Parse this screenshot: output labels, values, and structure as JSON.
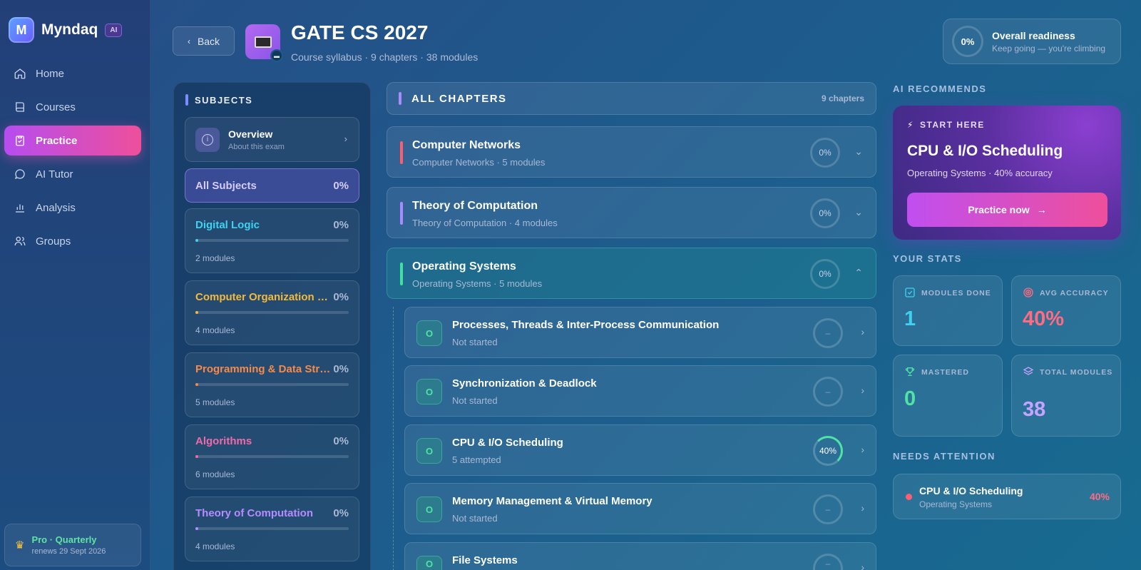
{
  "brand": {
    "name": "Myndaq",
    "badge": "AI",
    "logo_letter": "M"
  },
  "nav": {
    "items": [
      {
        "label": "Home",
        "icon": "home-icon"
      },
      {
        "label": "Courses",
        "icon": "book-icon"
      },
      {
        "label": "Practice",
        "icon": "clipboard-icon",
        "active": true
      },
      {
        "label": "AI Tutor",
        "icon": "chat-icon"
      },
      {
        "label": "Analysis",
        "icon": "bar-chart-icon"
      },
      {
        "label": "Groups",
        "icon": "users-icon"
      }
    ]
  },
  "plan": {
    "title": "Pro · Quarterly",
    "sub": "renews 29 Sept 2026",
    "icon": "crown-icon"
  },
  "header": {
    "back_label": "Back",
    "title": "GATE CS 2027",
    "subtitle": "Course syllabus · 9 chapters · 38 modules",
    "readiness": {
      "value": "0%",
      "title": "Overall readiness",
      "sub": "Keep going — you're climbing"
    }
  },
  "subjects": {
    "heading": "SUBJECTS",
    "overview": {
      "title": "Overview",
      "sub": "About this exam"
    },
    "all": {
      "label": "All Subjects",
      "pct": "0%"
    },
    "items": [
      {
        "name": "Digital Logic",
        "pct": "0%",
        "modules": "2 modules",
        "color": "#3fd2f0",
        "progress": 0
      },
      {
        "name": "Computer Organization …",
        "pct": "0%",
        "modules": "4 modules",
        "color": "#f5b93a",
        "progress": 0
      },
      {
        "name": "Programming & Data Str…",
        "pct": "0%",
        "modules": "5 modules",
        "color": "#f58a4a",
        "progress": 0
      },
      {
        "name": "Algorithms",
        "pct": "0%",
        "modules": "6 modules",
        "color": "#f06aa8",
        "progress": 0
      },
      {
        "name": "Theory of Computation",
        "pct": "0%",
        "modules": "4 modules",
        "color": "#b68bff",
        "progress": 0
      }
    ]
  },
  "chapters": {
    "heading": "ALL CHAPTERS",
    "count": "9 chapters",
    "items": [
      {
        "name": "Computer Networks",
        "sub": "Computer Networks · 5 modules",
        "pct": "0%",
        "color": "#ff5d6c",
        "chevron": "⌄"
      },
      {
        "name": "Theory of Computation",
        "sub": "Theory of Computation · 4 modules",
        "pct": "0%",
        "color": "#a98bff",
        "chevron": "⌄"
      },
      {
        "name": "Operating Systems",
        "sub": "Operating Systems · 5 modules",
        "pct": "0%",
        "color": "#3fe0a0",
        "chevron": "⌃"
      }
    ],
    "modules": [
      {
        "badge": "O",
        "name": "Processes, Threads & Inter-Process Communication",
        "status": "Not started",
        "score": "–"
      },
      {
        "badge": "O",
        "name": "Synchronization & Deadlock",
        "status": "Not started",
        "score": "–"
      },
      {
        "badge": "O",
        "name": "CPU & I/O Scheduling",
        "status": "5 attempted",
        "score": "40%",
        "progress": 0.4
      },
      {
        "badge": "O",
        "name": "Memory Management & Virtual Memory",
        "status": "Not started",
        "score": "–"
      },
      {
        "badge": "O",
        "name": "File Systems",
        "status": "",
        "score": "–"
      }
    ]
  },
  "recommend": {
    "section": "AI RECOMMENDS",
    "kicker": "START HERE",
    "title": "CPU & I/O Scheduling",
    "sub": "Operating Systems · 40% accuracy",
    "button": "Practice now"
  },
  "stats": {
    "section": "YOUR STATS",
    "items": [
      {
        "label": "MODULES DONE",
        "value": "1",
        "color": "#3fd2f0",
        "icon": "check-square-icon"
      },
      {
        "label": "AVG ACCURACY",
        "value": "40%",
        "color": "#ff6b81",
        "icon": "target-icon"
      },
      {
        "label": "MASTERED",
        "value": "0",
        "color": "#4fe3a5",
        "icon": "trophy-icon"
      },
      {
        "label": "TOTAL MODULES",
        "value": "38",
        "color": "#c5a3ff",
        "icon": "layers-icon"
      }
    ]
  },
  "attention": {
    "section": "NEEDS ATTENTION",
    "title": "CPU & I/O Scheduling",
    "sub": "Operating Systems",
    "pct": "40%"
  }
}
